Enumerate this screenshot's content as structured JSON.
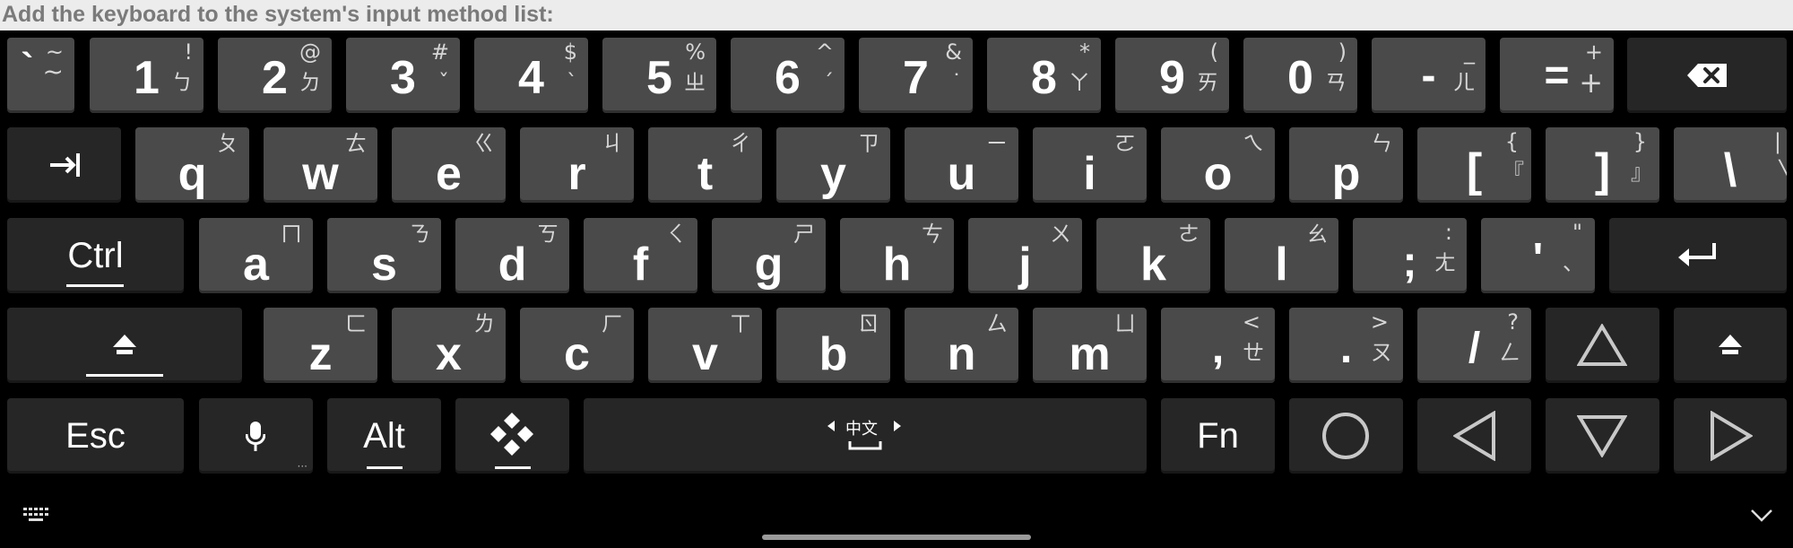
{
  "header": {
    "instruction": "Add the keyboard to the system's input method list:"
  },
  "keyboard": {
    "row1": {
      "backtick": {
        "main": "`",
        "alt_top": "~",
        "alt_bottom": "~"
      },
      "k1": {
        "main": "1",
        "alt_top": "!",
        "alt_bottom": "ㄅ"
      },
      "k2": {
        "main": "2",
        "alt_top": "@",
        "alt_bottom": "ㄉ"
      },
      "k3": {
        "main": "3",
        "alt_top": "#",
        "alt_bottom": "ˇ"
      },
      "k4": {
        "main": "4",
        "alt_top": "$",
        "alt_bottom": "ˋ"
      },
      "k5": {
        "main": "5",
        "alt_top": "%",
        "alt_bottom": "ㄓ"
      },
      "k6": {
        "main": "6",
        "alt_top": "^",
        "alt_bottom": "ˊ"
      },
      "k7": {
        "main": "7",
        "alt_top": "&",
        "alt_bottom": "˙"
      },
      "k8": {
        "main": "8",
        "alt_top": "*",
        "alt_bottom": "ㄚ"
      },
      "k9": {
        "main": "9",
        "alt_top": "(",
        "alt_bottom": "ㄞ"
      },
      "k0": {
        "main": "0",
        "alt_top": ")",
        "alt_bottom": "ㄢ"
      },
      "minus": {
        "main": "-",
        "alt_top": "_",
        "alt_bottom": "ㄦ"
      },
      "equals": {
        "main": "=",
        "alt_top": "+",
        "alt_bottom": "+"
      }
    },
    "row2": {
      "q": {
        "main": "q",
        "alt": "ㄆ"
      },
      "w": {
        "main": "w",
        "alt": "ㄊ"
      },
      "e": {
        "main": "e",
        "alt": "ㄍ"
      },
      "r": {
        "main": "r",
        "alt": "ㄐ"
      },
      "t": {
        "main": "t",
        "alt": "ㄔ"
      },
      "y": {
        "main": "y",
        "alt": "ㄗ"
      },
      "u": {
        "main": "u",
        "alt": "ㄧ"
      },
      "i": {
        "main": "i",
        "alt": "ㄛ"
      },
      "o": {
        "main": "o",
        "alt": "ㄟ"
      },
      "p": {
        "main": "p",
        "alt": "ㄣ"
      },
      "lbracket": {
        "main": "[",
        "alt_top": "{",
        "alt_bottom": "『"
      },
      "rbracket": {
        "main": "]",
        "alt_top": "}",
        "alt_bottom": "』"
      },
      "backslash": {
        "main": "\\",
        "alt_top": "|",
        "alt_bottom": "╲"
      }
    },
    "row3": {
      "ctrl": {
        "label": "Ctrl"
      },
      "a": {
        "main": "a",
        "alt": "ㄇ"
      },
      "s": {
        "main": "s",
        "alt": "ㄋ"
      },
      "d": {
        "main": "d",
        "alt": "ㄎ"
      },
      "f": {
        "main": "f",
        "alt": "ㄑ"
      },
      "g": {
        "main": "g",
        "alt": "ㄕ"
      },
      "h": {
        "main": "h",
        "alt": "ㄘ"
      },
      "j": {
        "main": "j",
        "alt": "ㄨ"
      },
      "k": {
        "main": "k",
        "alt": "ㄜ"
      },
      "l": {
        "main": "l",
        "alt": "ㄠ"
      },
      "semicolon": {
        "main": ";",
        "alt_top": ":",
        "alt_bottom": "ㄤ"
      },
      "quote": {
        "main": "'",
        "alt_top": "\"",
        "alt_bottom": "、"
      }
    },
    "row4": {
      "z": {
        "main": "z",
        "alt": "ㄈ"
      },
      "x": {
        "main": "x",
        "alt": "ㄌ"
      },
      "c": {
        "main": "c",
        "alt": "ㄏ"
      },
      "v": {
        "main": "v",
        "alt": "ㄒ"
      },
      "b": {
        "main": "b",
        "alt": "ㄖ"
      },
      "n": {
        "main": "n",
        "alt": "ㄙ"
      },
      "m": {
        "main": "m",
        "alt": "ㄩ"
      },
      "comma": {
        "main": ",",
        "alt_top": "<",
        "alt_bottom": "ㄝ"
      },
      "period": {
        "main": ".",
        "alt_top": ">",
        "alt_bottom": "ㄡ"
      },
      "slash": {
        "main": "/",
        "alt_top": "?",
        "alt_bottom": "ㄥ"
      }
    },
    "row5": {
      "esc": {
        "label": "Esc"
      },
      "alt": {
        "label": "Alt"
      },
      "space": {
        "label": "中文"
      },
      "fn": {
        "label": "Fn"
      }
    },
    "icons": {
      "backspace": "backspace-icon",
      "tab": "tab-icon",
      "enter": "enter-icon",
      "shift": "shift-icon",
      "mic": "microphone-icon",
      "dpad": "dpad-icon",
      "up": "triangle-up-icon",
      "down": "triangle-down-icon",
      "left": "triangle-left-icon",
      "right": "triangle-right-icon",
      "home": "circle-icon",
      "keyboard_switch": "keyboard-icon",
      "collapse": "chevron-down-icon"
    }
  }
}
